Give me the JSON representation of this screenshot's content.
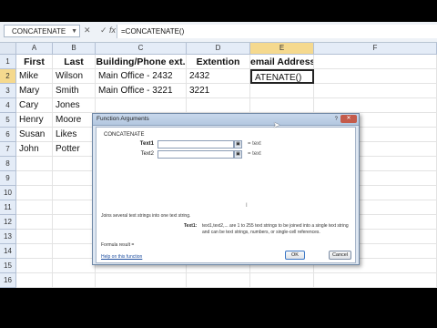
{
  "formula_bar": {
    "name_box": "CONCATENATE",
    "buttons": "✕ ✓",
    "fx": "fx",
    "formula": "=CONCATENATE()"
  },
  "columns": [
    "A",
    "B",
    "C",
    "D",
    "E",
    "F"
  ],
  "rows": [
    "1",
    "2",
    "3",
    "4",
    "5",
    "6",
    "7",
    "8",
    "9",
    "10",
    "11",
    "12",
    "13",
    "14",
    "15",
    "16"
  ],
  "sheet": {
    "header": [
      "First",
      "Last",
      "Building/Phone ext.",
      "Extention",
      "email Address"
    ],
    "data": [
      [
        "Mike",
        "Wilson",
        "Main Office - 2432",
        "2432",
        "ATENATE()"
      ],
      [
        "Mary",
        "Smith",
        "Main Office - 3221",
        "3221",
        ""
      ],
      [
        "Cary",
        "Jones",
        "",
        "",
        ""
      ],
      [
        "Henry",
        "Moore",
        "",
        "",
        ""
      ],
      [
        "Susan",
        "Likes",
        "",
        "",
        ""
      ],
      [
        "John",
        "Potter",
        "",
        "",
        ""
      ]
    ]
  },
  "dialog": {
    "title": "Function Arguments",
    "help": "?",
    "close": "✕",
    "function_name": "CONCATENATE",
    "args": [
      {
        "label": "Text1",
        "result": "= text"
      },
      {
        "label": "Text2",
        "result": "= text"
      }
    ],
    "arg_button": "▣",
    "cursor_mark": "I",
    "description": "Joins several text strings into one text string.",
    "arg_desc_label": "Text1:",
    "arg_desc": "text1,text2,... are 1 to 255 text strings to be joined into a single text string and can be text strings, numbers, or single-cell references.",
    "formula_result": "Formula result =",
    "help_link": "Help on this function",
    "ok": "OK",
    "cancel": "Cancel"
  },
  "colors": {
    "background": "#000000",
    "selected_header": "#f5d98e",
    "dialog_bg": "#dde6f1"
  }
}
